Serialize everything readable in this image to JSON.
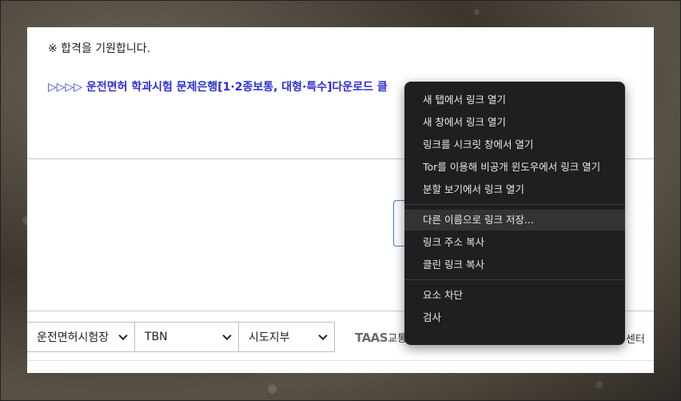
{
  "page": {
    "notice": "※ 합격을 기원합니다.",
    "download_link": "▷▷▷▷ 운전면허 학과시험 문제은행[1·2종보통, 대형·특수]다운로드 클"
  },
  "footer": {
    "selects": [
      {
        "value": "운전면허시험장"
      },
      {
        "value": "TBN"
      },
      {
        "value": "시도지부"
      }
    ],
    "taas_logo": "TAAS",
    "taas_label": "교통",
    "right_text": "센터"
  },
  "context_menu": {
    "groups": [
      [
        "새 탭에서 링크 열기",
        "새 창에서 링크 열기",
        "링크를 시크릿 창에서 열기",
        "Tor를 이용해 비공개 윈도우에서 링크 열기",
        "분할 보기에서 링크 열기"
      ],
      [
        "다른 이름으로 링크 저장...",
        "링크 주소 복사",
        "클린 링크 복사"
      ],
      [
        "요소 차단",
        "검사"
      ]
    ],
    "highlighted": "다른 이름으로 링크 저장..."
  },
  "colors": {
    "link": "#2d2fd6",
    "menu_bg": "#1f1f22",
    "menu_highlight": "#333336",
    "focus_border": "#3b7cd9"
  }
}
